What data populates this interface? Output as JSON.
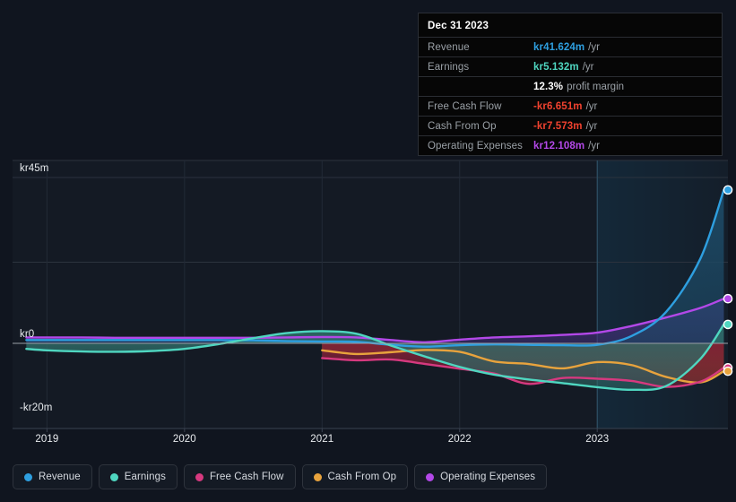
{
  "chart_data": {
    "type": "area",
    "title": "",
    "xlabel": "",
    "ylabel": "",
    "currency_prefix": "kr",
    "unit_suffix": "m",
    "ylim": [
      -20,
      45
    ],
    "xlim": [
      2018.75,
      2023.95
    ],
    "grid": true,
    "legend_position": "bottom",
    "y_ticks": [
      {
        "value": 45,
        "label": "kr45m"
      },
      {
        "value": 0,
        "label": "kr0"
      },
      {
        "value": -20,
        "label": "-kr20m"
      }
    ],
    "x_ticks": [
      {
        "value": 2019,
        "label": "2019"
      },
      {
        "value": 2020,
        "label": "2020"
      },
      {
        "value": 2021,
        "label": "2021"
      },
      {
        "value": 2022,
        "label": "2022"
      },
      {
        "value": 2023,
        "label": "2023"
      }
    ],
    "forecast_divider": {
      "value": 2023,
      "label": ""
    },
    "series": [
      {
        "name": "Revenue",
        "color": "#2e9fe0",
        "fill": "#1d4a66",
        "x": [
          2018.85,
          2019.0,
          2019.25,
          2019.5,
          2019.75,
          2020.0,
          2020.25,
          2020.5,
          2020.75,
          2021.0,
          2021.25,
          2021.5,
          2021.75,
          2022.0,
          2022.25,
          2022.5,
          2022.75,
          2023.0,
          2023.25,
          2023.5,
          2023.75,
          2023.92
        ],
        "values": [
          0.9,
          0.9,
          0.9,
          0.9,
          0.9,
          0.9,
          0.9,
          0.8,
          0.6,
          0.5,
          0.4,
          -0.4,
          -0.9,
          -0.5,
          -0.3,
          -0.4,
          -0.5,
          -0.4,
          2.0,
          8.5,
          23.0,
          41.624
        ]
      },
      {
        "name": "Earnings",
        "color": "#4fd6c0",
        "fill": "#2e6a66",
        "x": [
          2018.85,
          2019.0,
          2019.25,
          2019.5,
          2019.75,
          2020.0,
          2020.25,
          2020.5,
          2020.75,
          2021.0,
          2021.25,
          2021.5,
          2021.75,
          2022.0,
          2022.25,
          2022.5,
          2022.75,
          2023.0,
          2023.25,
          2023.5,
          2023.75,
          2023.92
        ],
        "values": [
          -1.5,
          -1.9,
          -2.2,
          -2.3,
          -2.1,
          -1.5,
          -0.2,
          1.4,
          2.8,
          3.3,
          2.6,
          -0.6,
          -3.6,
          -6.4,
          -8.5,
          -9.8,
          -10.8,
          -11.9,
          -12.6,
          -11.6,
          -4.2,
          5.132
        ]
      },
      {
        "name": "Free Cash Flow",
        "color": "#d6397f",
        "fill": "#7c2036",
        "x": [
          2021.0,
          2021.25,
          2021.5,
          2021.75,
          2022.0,
          2022.25,
          2022.5,
          2022.75,
          2023.0,
          2023.25,
          2023.5,
          2023.75,
          2023.92
        ],
        "values": [
          -4.0,
          -4.6,
          -4.4,
          -5.6,
          -6.9,
          -8.2,
          -11.0,
          -9.4,
          -9.6,
          -10.2,
          -11.8,
          -10.4,
          -6.651
        ]
      },
      {
        "name": "Cash From Op",
        "color": "#e8a33d",
        "fill": "#8a5520",
        "x": [
          2021.0,
          2021.25,
          2021.5,
          2021.75,
          2022.0,
          2022.25,
          2022.5,
          2022.75,
          2023.0,
          2023.25,
          2023.5,
          2023.75,
          2023.92
        ],
        "values": [
          -1.9,
          -2.9,
          -2.4,
          -1.8,
          -2.3,
          -4.9,
          -5.6,
          -6.8,
          -5.1,
          -5.9,
          -9.1,
          -10.6,
          -7.573
        ]
      },
      {
        "name": "Operating Expenses",
        "color": "#b348e8",
        "fill": "#43307a",
        "x": [
          2018.85,
          2019.0,
          2019.25,
          2019.5,
          2019.75,
          2020.0,
          2020.25,
          2020.5,
          2020.75,
          2021.0,
          2021.25,
          2021.5,
          2021.75,
          2022.0,
          2022.25,
          2022.5,
          2022.75,
          2023.0,
          2023.25,
          2023.5,
          2023.75,
          2023.92
        ],
        "values": [
          1.6,
          1.6,
          1.6,
          1.5,
          1.5,
          1.5,
          1.5,
          1.5,
          1.6,
          1.7,
          1.6,
          0.9,
          0.3,
          1.0,
          1.6,
          1.9,
          2.3,
          2.9,
          4.7,
          7.0,
          9.6,
          12.108
        ]
      }
    ],
    "endpoints": [
      {
        "series": "Revenue",
        "value": 41.624,
        "color": "#2e9fe0"
      },
      {
        "series": "Operating Expenses",
        "value": 12.108,
        "color": "#b348e8"
      },
      {
        "series": "Earnings",
        "value": 5.132,
        "color": "#4fd6c0"
      },
      {
        "series": "Free Cash Flow",
        "value": -6.651,
        "color": "#d6397f"
      },
      {
        "series": "Cash From Op",
        "value": -7.573,
        "color": "#e8a33d"
      }
    ]
  },
  "tooltip": {
    "title": "Dec 31 2023",
    "rows": [
      {
        "label": "Revenue",
        "value": "kr41.624m",
        "unit": "/yr",
        "color": "#2e9fe0"
      },
      {
        "label": "Earnings",
        "value": "kr5.132m",
        "unit": "/yr",
        "color": "#4fd6c0"
      },
      {
        "label": "",
        "value": "12.3%",
        "unit": "profit margin",
        "color": "#ffffff"
      },
      {
        "label": "Free Cash Flow",
        "value": "-kr6.651m",
        "unit": "/yr",
        "color": "#f0422f"
      },
      {
        "label": "Cash From Op",
        "value": "-kr7.573m",
        "unit": "/yr",
        "color": "#f0422f"
      },
      {
        "label": "Operating Expenses",
        "value": "kr12.108m",
        "unit": "/yr",
        "color": "#b348e8"
      }
    ]
  },
  "legend": {
    "items": [
      {
        "label": "Revenue",
        "color": "#2e9fe0"
      },
      {
        "label": "Earnings",
        "color": "#4fd6c0"
      },
      {
        "label": "Free Cash Flow",
        "color": "#d6397f"
      },
      {
        "label": "Cash From Op",
        "color": "#e8a33d"
      },
      {
        "label": "Operating Expenses",
        "color": "#b348e8"
      }
    ]
  }
}
